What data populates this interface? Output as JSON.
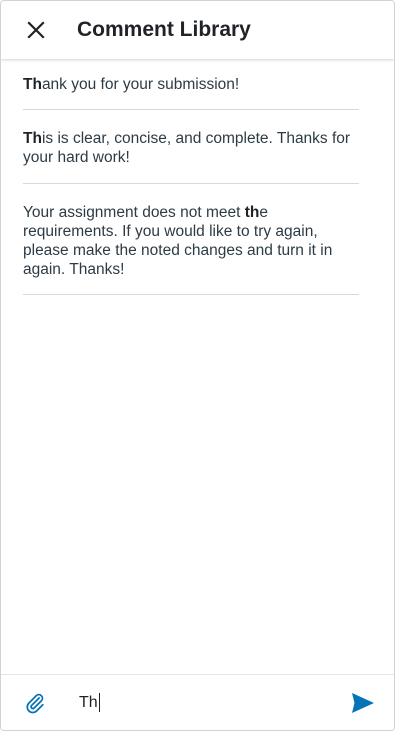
{
  "header": {
    "title": "Comment Library",
    "close_icon": "close-icon"
  },
  "comments": [
    {
      "match": "Th",
      "before": "",
      "after": "ank you for your submission!"
    },
    {
      "match": "Th",
      "before": "",
      "after": "is is clear, concise, and complete. Thanks for your hard work!"
    },
    {
      "match": "th",
      "before": "Your assignment does not meet ",
      "after": "e requirements. If you would like to try again, please make the noted changes and turn it in again. Thanks!"
    }
  ],
  "composer": {
    "value": "Th",
    "attach_icon": "paperclip-icon",
    "send_icon": "send-icon"
  },
  "colors": {
    "accent": "#0374b5",
    "text": "#2d3b45",
    "divider": "#d7dadc"
  }
}
